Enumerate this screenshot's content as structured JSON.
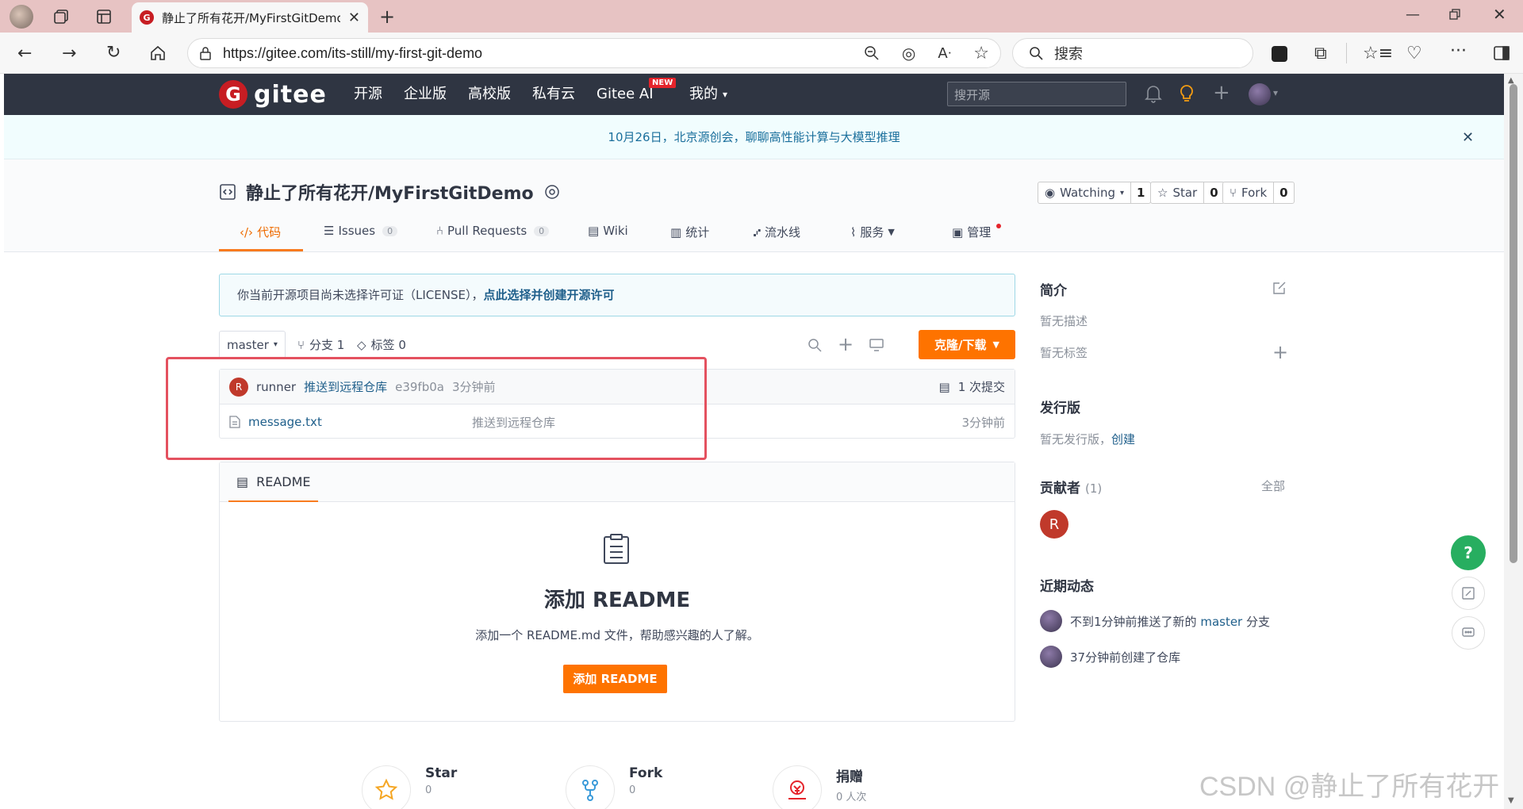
{
  "browser": {
    "tab_title": "静止了所有花开/MyFirstGitDemo",
    "url": "https://gitee.com/its-still/my-first-git-demo",
    "search_label": "搜索"
  },
  "nav": {
    "logo": "gitee",
    "items": [
      "开源",
      "企业版",
      "高校版",
      "私有云",
      "Gitee AI",
      "我的"
    ],
    "new_badge": "NEW",
    "search_placeholder": "搜开源"
  },
  "banner": {
    "text": "10月26日，北京源创会，聊聊高性能计算与大模型推理"
  },
  "repo": {
    "title": "静止了所有花开/MyFirstGitDemo",
    "watch_label": "Watching",
    "watch_count": "1",
    "star_label": "Star",
    "star_count": "0",
    "fork_label": "Fork",
    "fork_count": "0"
  },
  "tabs": [
    {
      "label": "代码"
    },
    {
      "label": "Issues",
      "count": "0"
    },
    {
      "label": "Pull Requests",
      "count": "0"
    },
    {
      "label": "Wiki"
    },
    {
      "label": "统计"
    },
    {
      "label": "流水线"
    },
    {
      "label": "服务"
    },
    {
      "label": "管理"
    }
  ],
  "license_notice": {
    "text": "你当前开源项目尚未选择许可证（LICENSE），",
    "link": "点此选择并创建开源许可"
  },
  "branch": {
    "name": "master",
    "branches": "分支 1",
    "tags": "标签 0",
    "clone_label": "克隆/下载"
  },
  "commit": {
    "avatar": "R",
    "author": "runner",
    "message": "推送到远程仓库",
    "hash": "e39fb0a",
    "time": "3分钟前",
    "count": "1 次提交"
  },
  "files": [
    {
      "name": "message.txt",
      "message": "推送到远程仓库",
      "time": "3分钟前"
    }
  ],
  "readme": {
    "tab": "README",
    "title": "添加 README",
    "subtitle": "添加一个 README.md 文件，帮助感兴趣的人了解。",
    "button": "添加 README"
  },
  "bottom_stats": [
    {
      "label": "Star",
      "value": "0"
    },
    {
      "label": "Fork",
      "value": "0"
    },
    {
      "label": "捐赠",
      "value": "0 人次"
    }
  ],
  "sidebar": {
    "intro_title": "简介",
    "no_desc": "暂无描述",
    "no_tags": "暂无标签",
    "release_title": "发行版",
    "no_release": "暂无发行版，",
    "create": "创建",
    "contrib_title": "贡献者",
    "contrib_count": "(1)",
    "all": "全部",
    "contrib_avatar": "R",
    "activity_title": "近期动态",
    "activity": [
      {
        "pre": "不到1分钟前推送了新的 ",
        "branch": "master",
        "post": " 分支"
      },
      {
        "pre": "37分钟前创建了仓库",
        "branch": "",
        "post": ""
      }
    ]
  },
  "float": {
    "help": "?"
  },
  "watermark": "CSDN @静止了所有花开"
}
